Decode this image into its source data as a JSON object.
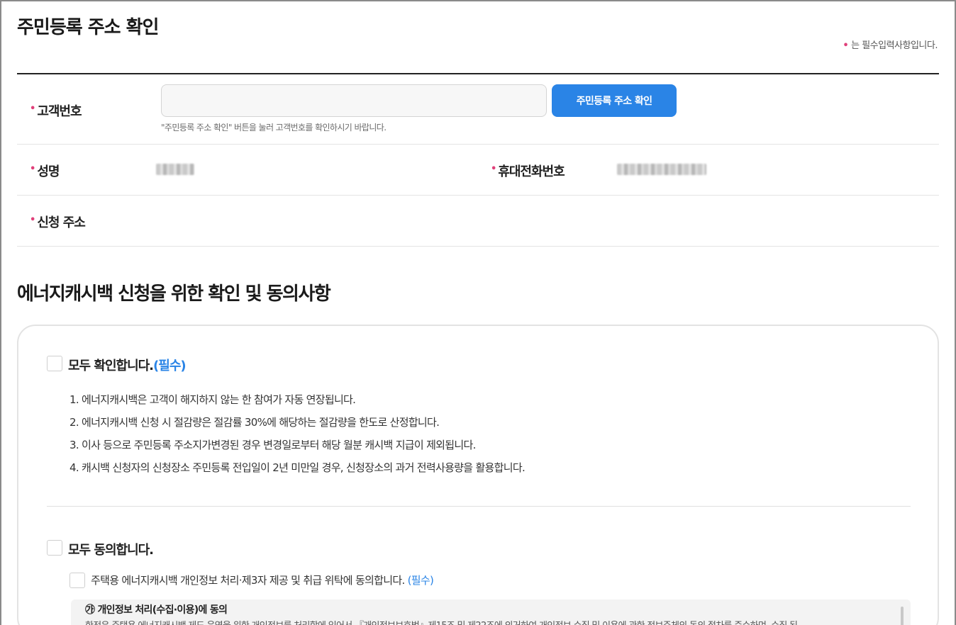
{
  "page": {
    "title": "주민등록 주소 확인",
    "required_note": "는 필수입력사항입니다.",
    "required_mark": "•"
  },
  "form": {
    "customer_number": {
      "label": "고객번호",
      "value": "",
      "placeholder": "",
      "button_label": "주민등록 주소 확인",
      "help": "\"주민등록 주소 확인\" 버튼을 눌러 고객번호를 확인하시기 바랍니다."
    },
    "name": {
      "label": "성명"
    },
    "phone": {
      "label": "휴대전화번호"
    },
    "address": {
      "label": "신청 주소"
    }
  },
  "agreement": {
    "section_title": "에너지캐시백 신청을 위한 확인 및 동의사항",
    "confirm_all": {
      "label": "모두 확인합니다.",
      "required": "(필수)"
    },
    "notices": [
      "1. 에너지캐시백은 고객이 해지하지 않는 한 참여가 자동 연장됩니다.",
      "2. 에너지캐시백 신청 시 절감량은 절감률 30%에 해당하는 절감량을 한도로 산정합니다.",
      "3. 이사 등으로 주민등록 주소지가변경된 경우 변경일로부터 해당 월분 캐시백 지급이 제외됩니다.",
      "4. 캐시백 신청자의 신청장소 주민등록 전입일이 2년 미만일 경우, 신청장소의 과거 전력사용량을 활용합니다."
    ],
    "agree_all": {
      "label": "모두 동의합니다."
    },
    "privacy_consent": {
      "label": "주택용 에너지캐시백 개인정보 처리·제3자 제공 및 취급 위탁에 동의합니다.",
      "required": "(필수)"
    },
    "privacy_detail": {
      "title": "㉮ 개인정보 처리(수집·이용)에 동의",
      "body": "한전은 주택용 에너지캐시백 제도 운영을 위한 개인정보를 처리함에 있어서 『개인정보보호법』제15조 및 제22조에 의거하여 개인정보 수집 및 이용에 관한 정보주체의 동의 절차를 준수하며, 수집 된"
    }
  }
}
